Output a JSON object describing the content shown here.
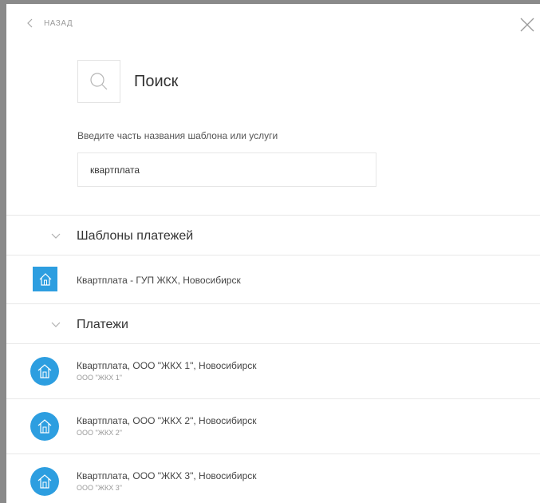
{
  "nav": {
    "back_label": "НАЗАД"
  },
  "search": {
    "title": "Поиск",
    "hint": "Введите часть названия шаблона или услуги",
    "value": "квартплата"
  },
  "templates_section": {
    "label": "Шаблоны платежей",
    "items": [
      {
        "title": "Квартплата - ГУП ЖКХ, Новосибирск"
      }
    ]
  },
  "payments_section": {
    "label": "Платежи",
    "items": [
      {
        "title": "Квартплата, ООО \"ЖКХ 1\", Новосибирск",
        "subtitle": "ООО \"ЖКХ 1\""
      },
      {
        "title": "Квартплата, ООО \"ЖКХ 2\", Новосибирск",
        "subtitle": "ООО \"ЖКХ 2\""
      },
      {
        "title": "Квартплата, ООО \"ЖКХ 3\", Новосибирск",
        "subtitle": "ООО \"ЖКХ 3\""
      }
    ]
  },
  "icons": {
    "back": "chevron-left-icon",
    "close": "close-icon",
    "search": "search-icon",
    "section_toggle": "chevron-down-icon",
    "template_item": "house-icon",
    "payment_item": "house-icon"
  },
  "colors": {
    "accent": "#2d9ee0"
  }
}
